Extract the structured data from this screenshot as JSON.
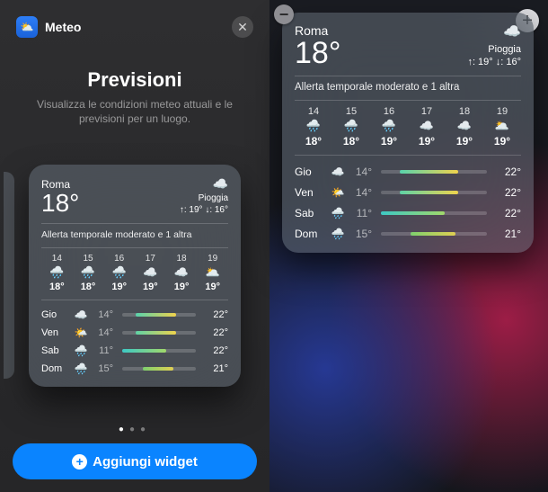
{
  "domain": "Computer-Use",
  "gallery": {
    "app_name": "Meteo",
    "close_glyph": "✕",
    "title": "Previsioni",
    "description": "Visualizza le condizioni meteo attuali e le previsioni per un luogo.",
    "page_dots": {
      "count": 3,
      "active": 0
    },
    "add_button": "Aggiungi widget"
  },
  "widget": {
    "city": "Roma",
    "temp": "18°",
    "condition": "Pioggia",
    "hilo": "↑: 19° ↓: 16°",
    "alert": "Allerta temporale moderato e 1 altra",
    "hourly": [
      {
        "h": "14",
        "icon": "🌧️",
        "t": "18°"
      },
      {
        "h": "15",
        "icon": "🌧️",
        "t": "18°"
      },
      {
        "h": "16",
        "icon": "🌧️",
        "t": "19°"
      },
      {
        "h": "17",
        "icon": "☁️",
        "t": "19°"
      },
      {
        "h": "18",
        "icon": "☁️",
        "t": "19°"
      },
      {
        "h": "19",
        "icon": "🌥️",
        "t": "19°"
      }
    ],
    "daily": [
      {
        "d": "Gio",
        "icon": "☁️",
        "lo": "14°",
        "hi": "22°",
        "bar": "b-gio"
      },
      {
        "d": "Ven",
        "icon": "🌤️",
        "lo": "14°",
        "hi": "22°",
        "bar": "b-ven"
      },
      {
        "d": "Sab",
        "icon": "🌧️",
        "lo": "11°",
        "hi": "22°",
        "bar": "b-sab"
      },
      {
        "d": "Dom",
        "icon": "🌧️",
        "lo": "15°",
        "hi": "21°",
        "bar": "b-dom"
      }
    ]
  },
  "homescreen": {
    "remove_glyph": "−",
    "add_glyph": "+"
  },
  "icons": {
    "weather_app": "⛅",
    "condition": "☁️"
  }
}
